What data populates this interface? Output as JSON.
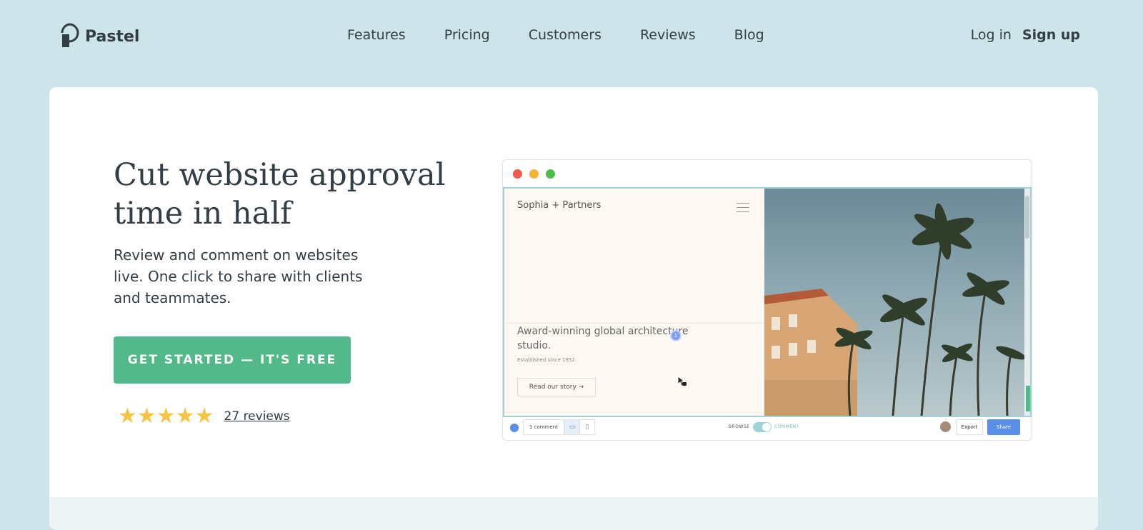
{
  "brand": {
    "name": "Pastel"
  },
  "nav": {
    "links": [
      "Features",
      "Pricing",
      "Customers",
      "Reviews",
      "Blog"
    ],
    "login": "Log in",
    "signup": "Sign up"
  },
  "hero": {
    "headline": "Cut website approval time in half",
    "subtext": "Review and comment on websites live. One click to share with clients and teammates.",
    "cta": "GET STARTED — IT'S FREE",
    "rating": {
      "stars": 5,
      "reviews_label": "27 reviews"
    }
  },
  "mockup": {
    "site_name": "Sophia + Partners",
    "tagline": "Award-winning global architecture studio.",
    "established": "Established since 1952.",
    "story_button": "Read our story →",
    "comment_pin": "1",
    "toolbar": {
      "comments": "1 comment",
      "browse": "BROWSE",
      "comment": "COMMENT",
      "export": "Export",
      "share": "Share"
    }
  },
  "colors": {
    "page_bg": "#cde4eb",
    "cta": "#52b98a",
    "star": "#f5c545",
    "share": "#5b8ee6"
  }
}
